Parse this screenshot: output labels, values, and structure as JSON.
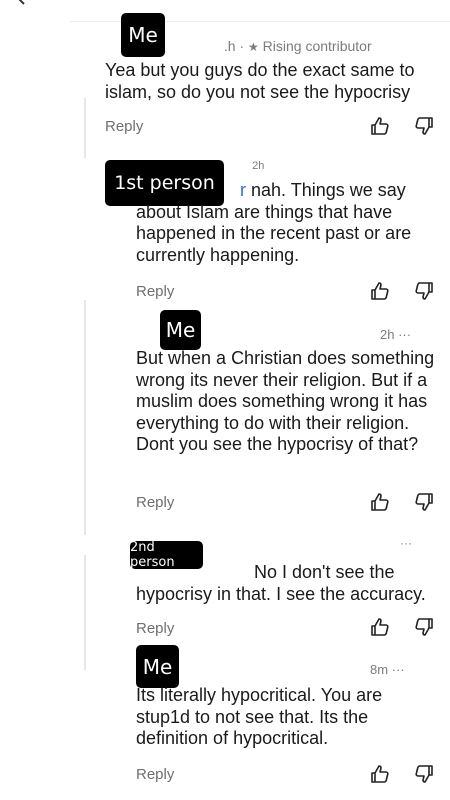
{
  "comments": [
    {
      "label": "Me",
      "meta": " .h · ",
      "badge": "Rising contributor",
      "text": "Yea but you guys do the exact same to islam, so do you not see the hypocrisy",
      "reply": "Reply"
    },
    {
      "label": "1st person",
      "time": "  2h",
      "link_char": "r",
      "text_first": " nah. Things we say",
      "text_rest": "about Islam are things that have happened in the recent past or are currently happening.",
      "reply": "Reply"
    },
    {
      "label": "Me",
      "time": "2h ···",
      "text": "But when a Christian does something wrong its never their religion. But if a muslim does something wrong it has everything to do with their religion. Dont you see the hypocrisy of that?",
      "reply": "Reply"
    },
    {
      "label": "2nd person",
      "time": "···",
      "text_first": "No I don't see the",
      "text_rest": "hypocrisy in that. I see the accuracy.",
      "reply": "Reply"
    },
    {
      "label": "Me",
      "time": "8m ···",
      "text": "Its literally hypocritical. You are stup1d to not see that. Its the definition of hypocritical.",
      "reply": "Reply"
    }
  ],
  "icons": {
    "upvote": "thumbs-up-icon",
    "downvote": "thumbs-down-icon",
    "back": "back-arrow-icon",
    "badge": "star-icon"
  }
}
